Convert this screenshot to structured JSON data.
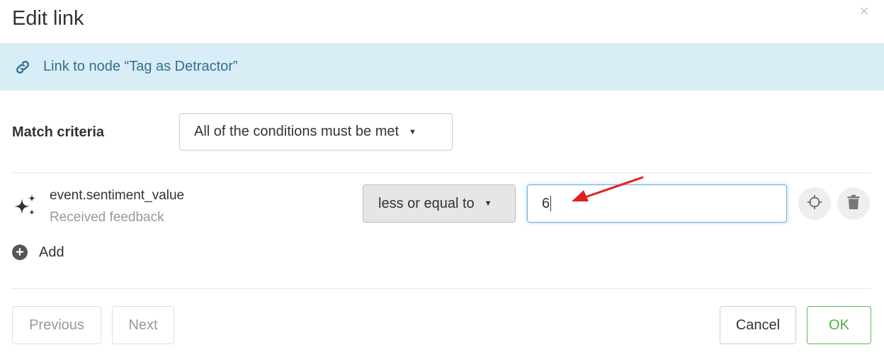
{
  "dialog": {
    "title": "Edit link",
    "close_symbol": "×"
  },
  "banner": {
    "icon": "link-icon",
    "text": "Link to node “Tag as Detractor”",
    "background": "#d9edf7",
    "text_color": "#31708f"
  },
  "match_criteria": {
    "label": "Match criteria",
    "selected": "All of the conditions must be met"
  },
  "condition": {
    "icon": "sparkles-icon",
    "field": "event.sentiment_value",
    "source": "Received feedback",
    "operator": "less or equal to",
    "value": "6"
  },
  "add": {
    "label": "Add"
  },
  "footer": {
    "previous": "Previous",
    "next": "Next",
    "cancel": "Cancel",
    "ok": "OK"
  },
  "colors": {
    "ok_accent": "#5cb85c",
    "input_focus": "#66afe9",
    "annotation_arrow": "#e02020"
  }
}
